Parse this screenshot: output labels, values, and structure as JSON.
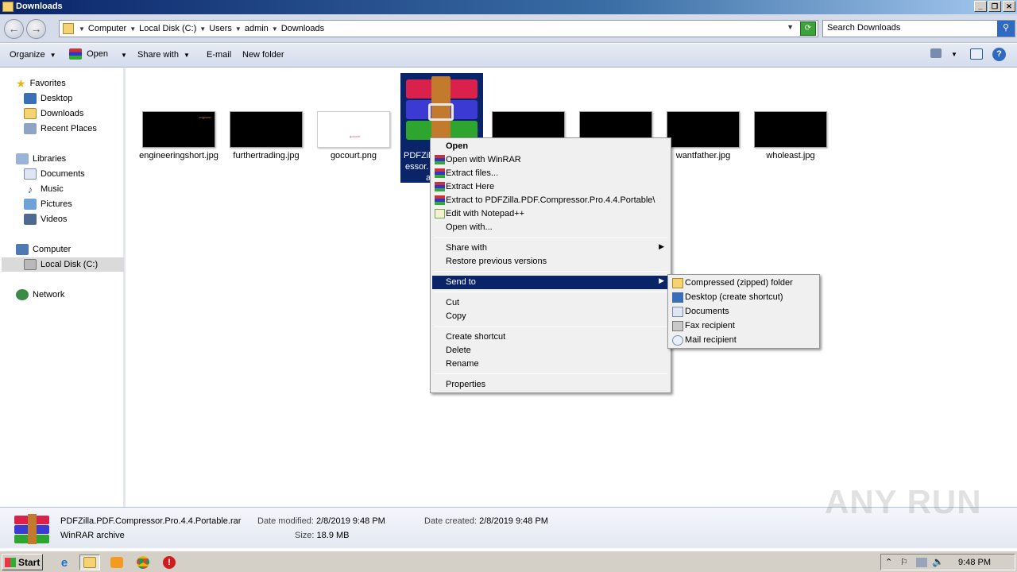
{
  "window": {
    "title": "Downloads"
  },
  "address": {
    "crumbs": [
      "Computer",
      "Local Disk (C:)",
      "Users",
      "admin",
      "Downloads"
    ],
    "search_placeholder": "Search Downloads"
  },
  "toolbar": {
    "organize": "Organize",
    "open": "Open",
    "share_with": "Share with",
    "email": "E-mail",
    "new_folder": "New folder"
  },
  "nav": {
    "favorites": "Favorites",
    "desktop": "Desktop",
    "downloads": "Downloads",
    "recent_places": "Recent Places",
    "libraries": "Libraries",
    "documents": "Documents",
    "music": "Music",
    "pictures": "Pictures",
    "videos": "Videos",
    "computer": "Computer",
    "local_disk": "Local Disk (C:)",
    "network": "Network"
  },
  "files": [
    {
      "name": "engineeringshort.jpg",
      "thumb_text": "engineer"
    },
    {
      "name": "furthertrading.jpg"
    },
    {
      "name": "gocourt.png",
      "thumb_text": "gocourt"
    },
    {
      "name": "PDFZilla.PDF.Compressor.Pro.4.4.Portable.rar",
      "visible_label_1": "PDFZilla",
      "visible_label_2": "essor.",
      "visible_label_3": "a"
    },
    {
      "name": "wantfather.jpg"
    },
    {
      "name": "wholeast.jpg"
    }
  ],
  "context_menu": {
    "open": "Open",
    "open_winrar": "Open with WinRAR",
    "extract_files": "Extract files...",
    "extract_here": "Extract Here",
    "extract_to": "Extract to PDFZilla.PDF.Compressor.Pro.4.4.Portable\\",
    "edit_notepad": "Edit with Notepad++",
    "open_with": "Open with...",
    "share_with": "Share with",
    "restore": "Restore previous versions",
    "send_to": "Send to",
    "cut": "Cut",
    "copy": "Copy",
    "create_shortcut": "Create shortcut",
    "delete": "Delete",
    "rename": "Rename",
    "properties": "Properties"
  },
  "send_to_menu": {
    "compressed": "Compressed (zipped) folder",
    "desktop": "Desktop (create shortcut)",
    "documents": "Documents",
    "fax": "Fax recipient",
    "mail": "Mail recipient"
  },
  "details": {
    "filename": "PDFZilla.PDF.Compressor.Pro.4.4.Portable.rar",
    "type": "WinRAR archive",
    "date_modified_label": "Date modified:",
    "date_modified": "2/8/2019 9:48 PM",
    "size_label": "Size:",
    "size": "18.9 MB",
    "date_created_label": "Date created:",
    "date_created": "2/8/2019 9:48 PM"
  },
  "watermark": "ANY RUN",
  "taskbar": {
    "start": "Start",
    "clock": "9:48 PM"
  }
}
